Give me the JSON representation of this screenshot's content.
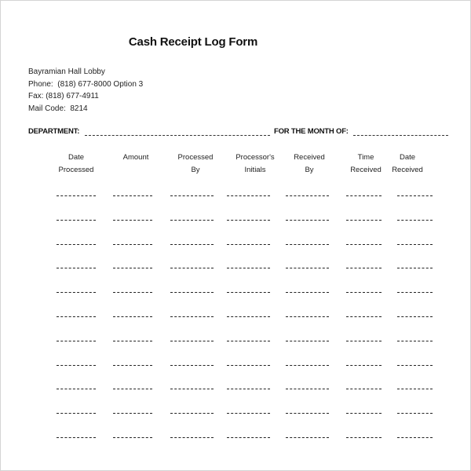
{
  "document": {
    "title": "Cash Receipt Log Form",
    "address_lines": [
      "Bayramian Hall Lobby",
      "Phone:  (818) 677-8000 Option 3",
      "Fax: (818) 677-4911",
      "Mail Code:  8214"
    ],
    "department_label": "DEPARTMENT:",
    "department_value": "",
    "month_label": "FOR THE MONTH OF:",
    "month_value": ""
  },
  "table": {
    "columns": [
      {
        "line1": "Date",
        "line2": "Processed"
      },
      {
        "line1": "Amount",
        "line2": ""
      },
      {
        "line1": "Processed",
        "line2": "By"
      },
      {
        "line1": "Processor's",
        "line2": "Initials"
      },
      {
        "line1": "Received",
        "line2": "By"
      },
      {
        "line1": "Time",
        "line2": "Received"
      },
      {
        "line1": "Date",
        "line2": "Received"
      }
    ],
    "row_count": 11
  }
}
